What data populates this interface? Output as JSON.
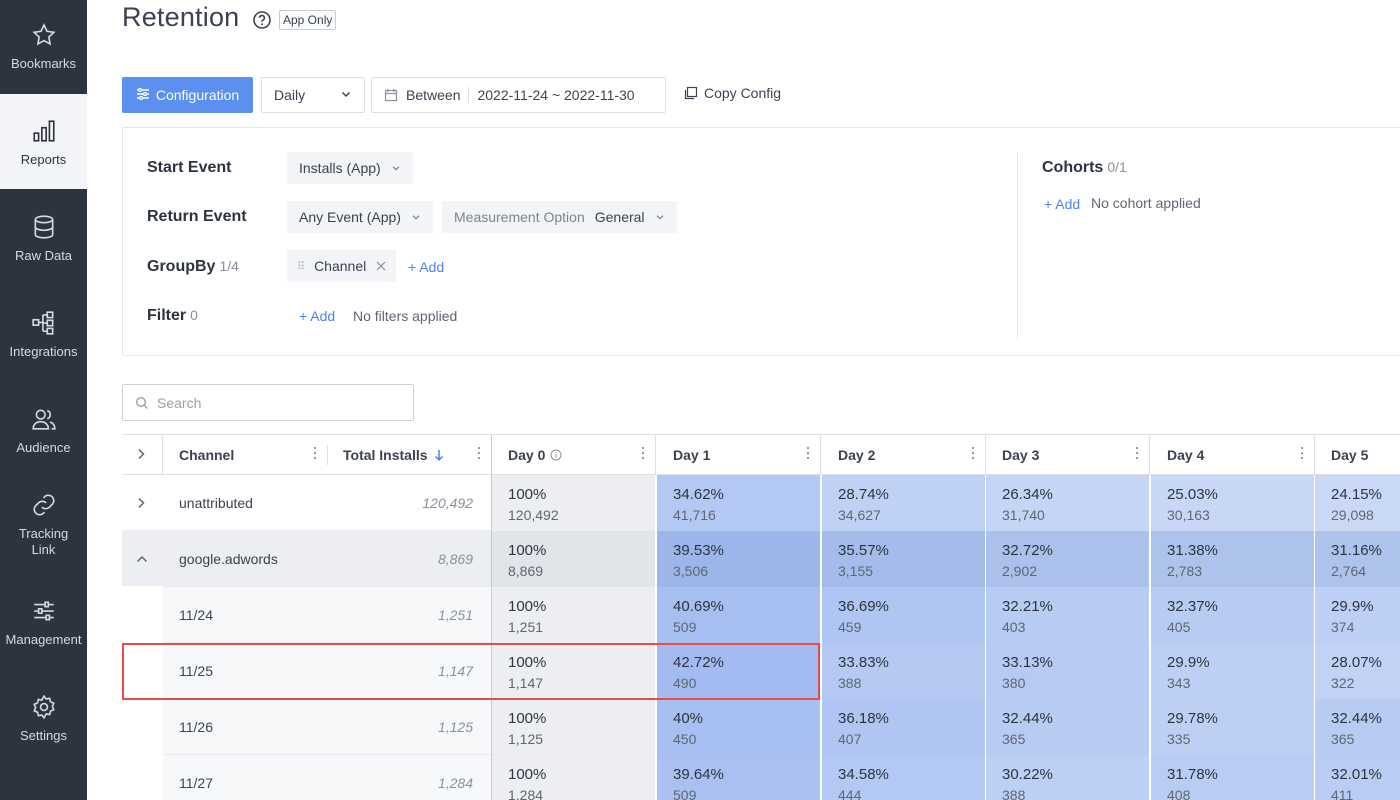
{
  "sidebar": {
    "items": [
      {
        "label": "Bookmarks",
        "icon": "star-icon"
      },
      {
        "label": "Reports",
        "icon": "bar-chart-icon",
        "active": true
      },
      {
        "label": "Raw Data",
        "icon": "database-icon"
      },
      {
        "label": "Integrations",
        "icon": "integrations-icon"
      },
      {
        "label": "Audience",
        "icon": "users-icon"
      },
      {
        "label": "Tracking\nLink",
        "icon": "link-icon"
      },
      {
        "label": "Management",
        "icon": "sliders-icon"
      },
      {
        "label": "Settings",
        "icon": "gear-icon"
      }
    ]
  },
  "header": {
    "title": "Retention",
    "tag": "App Only"
  },
  "toolbar": {
    "config_label": "Configuration",
    "period_value": "Daily",
    "date_prefix": "Between",
    "date_range": "2022-11-24 ~ 2022-11-30",
    "copy_label": "Copy Config"
  },
  "config": {
    "start_event": {
      "label": "Start Event",
      "value": "Installs (App)"
    },
    "return_event": {
      "label": "Return Event",
      "value": "Any Event (App)",
      "measurement_label": "Measurement Option",
      "measurement_value": "General"
    },
    "groupby": {
      "label": "GroupBy",
      "count": "1/4",
      "chip": "Channel",
      "add": "+ Add"
    },
    "filter": {
      "label": "Filter",
      "count": "0",
      "add": "+ Add",
      "empty": "No filters applied"
    },
    "cohorts": {
      "label": "Cohorts",
      "count": "0/1",
      "add": "+ Add",
      "empty": "No cohort applied"
    }
  },
  "search": {
    "placeholder": "Search"
  },
  "table": {
    "columns": {
      "channel": "Channel",
      "total": "Total Installs",
      "days": [
        "Day 0",
        "Day 1",
        "Day 2",
        "Day 3",
        "Day 4",
        "Day 5"
      ]
    },
    "rows": [
      {
        "label": "unattributed",
        "total": "120,492",
        "expander": "collapsed",
        "indent": false,
        "cells": [
          [
            "100%",
            "120,492"
          ],
          [
            "34.62%",
            "41,716"
          ],
          [
            "28.74%",
            "34,627"
          ],
          [
            "26.34%",
            "31,740"
          ],
          [
            "25.03%",
            "30,163"
          ],
          [
            "24.15%",
            "29,098"
          ]
        ]
      },
      {
        "label": "google.adwords",
        "total": "8,869",
        "expander": "expanded",
        "indent": false,
        "cells": [
          [
            "100%",
            "8,869"
          ],
          [
            "39.53%",
            "3,506"
          ],
          [
            "35.57%",
            "3,155"
          ],
          [
            "32.72%",
            "2,902"
          ],
          [
            "31.38%",
            "2,783"
          ],
          [
            "31.16%",
            "2,764"
          ]
        ]
      },
      {
        "label": "11/24",
        "total": "1,251",
        "expander": "none",
        "indent": true,
        "cells": [
          [
            "100%",
            "1,251"
          ],
          [
            "40.69%",
            "509"
          ],
          [
            "36.69%",
            "459"
          ],
          [
            "32.21%",
            "403"
          ],
          [
            "32.37%",
            "405"
          ],
          [
            "29.9%",
            "374"
          ]
        ]
      },
      {
        "label": "11/25",
        "total": "1,147",
        "expander": "none",
        "indent": true,
        "cells": [
          [
            "100%",
            "1,147"
          ],
          [
            "42.72%",
            "490"
          ],
          [
            "33.83%",
            "388"
          ],
          [
            "33.13%",
            "380"
          ],
          [
            "29.9%",
            "343"
          ],
          [
            "28.07%",
            "322"
          ]
        ]
      },
      {
        "label": "11/26",
        "total": "1,125",
        "expander": "none",
        "indent": true,
        "cells": [
          [
            "100%",
            "1,125"
          ],
          [
            "40%",
            "450"
          ],
          [
            "36.18%",
            "407"
          ],
          [
            "32.44%",
            "365"
          ],
          [
            "29.78%",
            "335"
          ],
          [
            "32.44%",
            "365"
          ]
        ]
      },
      {
        "label": "11/27",
        "total": "1,284",
        "expander": "none",
        "indent": true,
        "cells": [
          [
            "100%",
            "1,284"
          ],
          [
            "39.64%",
            "509"
          ],
          [
            "34.58%",
            "444"
          ],
          [
            "30.22%",
            "388"
          ],
          [
            "31.78%",
            "408"
          ],
          [
            "32.01%",
            "411"
          ]
        ]
      }
    ]
  },
  "colors": {
    "sidebar_bg": "#2d3440",
    "accent": "#5b8ff0",
    "link": "#4b84ee",
    "highlight_border": "#e74c4c"
  }
}
